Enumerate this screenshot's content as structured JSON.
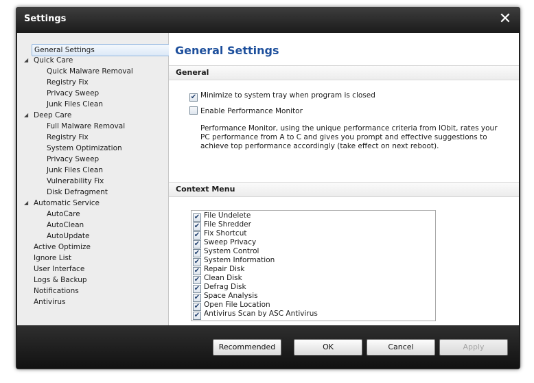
{
  "window": {
    "title": "Settings",
    "close_glyph": "✕"
  },
  "sidebar": {
    "items": [
      {
        "label": "General Settings",
        "selected": true
      },
      {
        "label": "Quick Care",
        "expanded": true
      },
      {
        "label": "Quick Malware Removal"
      },
      {
        "label": "Registry Fix"
      },
      {
        "label": "Privacy Sweep"
      },
      {
        "label": "Junk Files Clean"
      },
      {
        "label": "Deep Care",
        "expanded": true
      },
      {
        "label": "Full Malware Removal"
      },
      {
        "label": "Registry Fix"
      },
      {
        "label": "System Optimization"
      },
      {
        "label": "Privacy Sweep"
      },
      {
        "label": "Junk Files Clean"
      },
      {
        "label": "Vulnerability Fix"
      },
      {
        "label": "Disk Defragment"
      },
      {
        "label": "Automatic Service",
        "expanded": true
      },
      {
        "label": "AutoCare"
      },
      {
        "label": "AutoClean"
      },
      {
        "label": "AutoUpdate"
      },
      {
        "label": "Active Optimize"
      },
      {
        "label": "Ignore List"
      },
      {
        "label": "User Interface"
      },
      {
        "label": "Logs & Backup"
      },
      {
        "label": "Notifications"
      },
      {
        "label": "Antivirus"
      }
    ]
  },
  "main": {
    "title": "General Settings",
    "general": {
      "header": "General",
      "minimize_tray": {
        "label": "Minimize to system tray when program is closed",
        "checked": true
      },
      "perf_monitor": {
        "label": "Enable Performance Monitor",
        "checked": false
      },
      "description": "Performance Monitor, using the unique performance criteria from IObit, rates your PC performance from A to C and gives you prompt and effective suggestions to achieve top performance accordingly (take effect on next reboot)."
    },
    "context_menu": {
      "header": "Context Menu",
      "items": [
        {
          "label": "File Undelete",
          "checked": true
        },
        {
          "label": "File Shredder",
          "checked": true
        },
        {
          "label": "Fix Shortcut",
          "checked": true
        },
        {
          "label": "Sweep Privacy",
          "checked": true
        },
        {
          "label": "System Control",
          "checked": true
        },
        {
          "label": "System Information",
          "checked": true
        },
        {
          "label": "Repair Disk",
          "checked": true
        },
        {
          "label": "Clean Disk",
          "checked": true
        },
        {
          "label": "Defrag Disk",
          "checked": true
        },
        {
          "label": "Space Analysis",
          "checked": true
        },
        {
          "label": "Open File Location",
          "checked": true
        },
        {
          "label": "Antivirus Scan by ASC Antivirus",
          "checked": true
        }
      ]
    }
  },
  "footer": {
    "recommended": "Recommended",
    "ok": "OK",
    "cancel": "Cancel",
    "apply": "Apply",
    "apply_enabled": false
  },
  "check_glyph": "✔",
  "expander_glyph": "◢"
}
